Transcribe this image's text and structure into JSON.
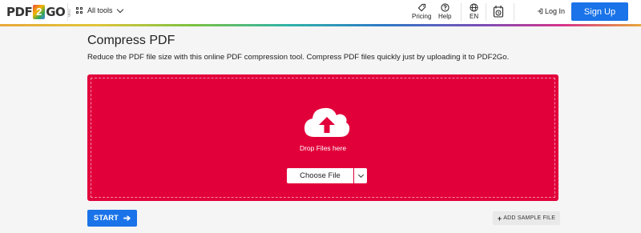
{
  "header": {
    "logo": {
      "left": "PDF",
      "middle": "2",
      "right": "GO",
      "suffix": ".com"
    },
    "all_tools_label": "All tools",
    "pricing_label": "Pricing",
    "help_label": "Help",
    "language_label": "EN",
    "login_label": "Log In",
    "signup_label": "Sign Up"
  },
  "main": {
    "title": "Compress PDF",
    "subtitle": "Reduce the PDF file size with this online PDF compression tool. Compress PDF files quickly just by uploading it to PDF2Go.",
    "dropzone": {
      "drop_text": "Drop Files here",
      "choose_file_label": "Choose File"
    },
    "start_label": "START",
    "add_sample_label": "ADD SAMPLE FILE"
  },
  "colors": {
    "dropzone_bg": "#e2003b",
    "primary_button": "#1a73e8"
  },
  "icons": [
    "grid-icon",
    "tag-icon",
    "help-icon",
    "globe-icon",
    "history-icon",
    "login-icon",
    "cloud-upload-icon",
    "arrow-right-icon",
    "plus-icon",
    "chevron-down-icon"
  ]
}
